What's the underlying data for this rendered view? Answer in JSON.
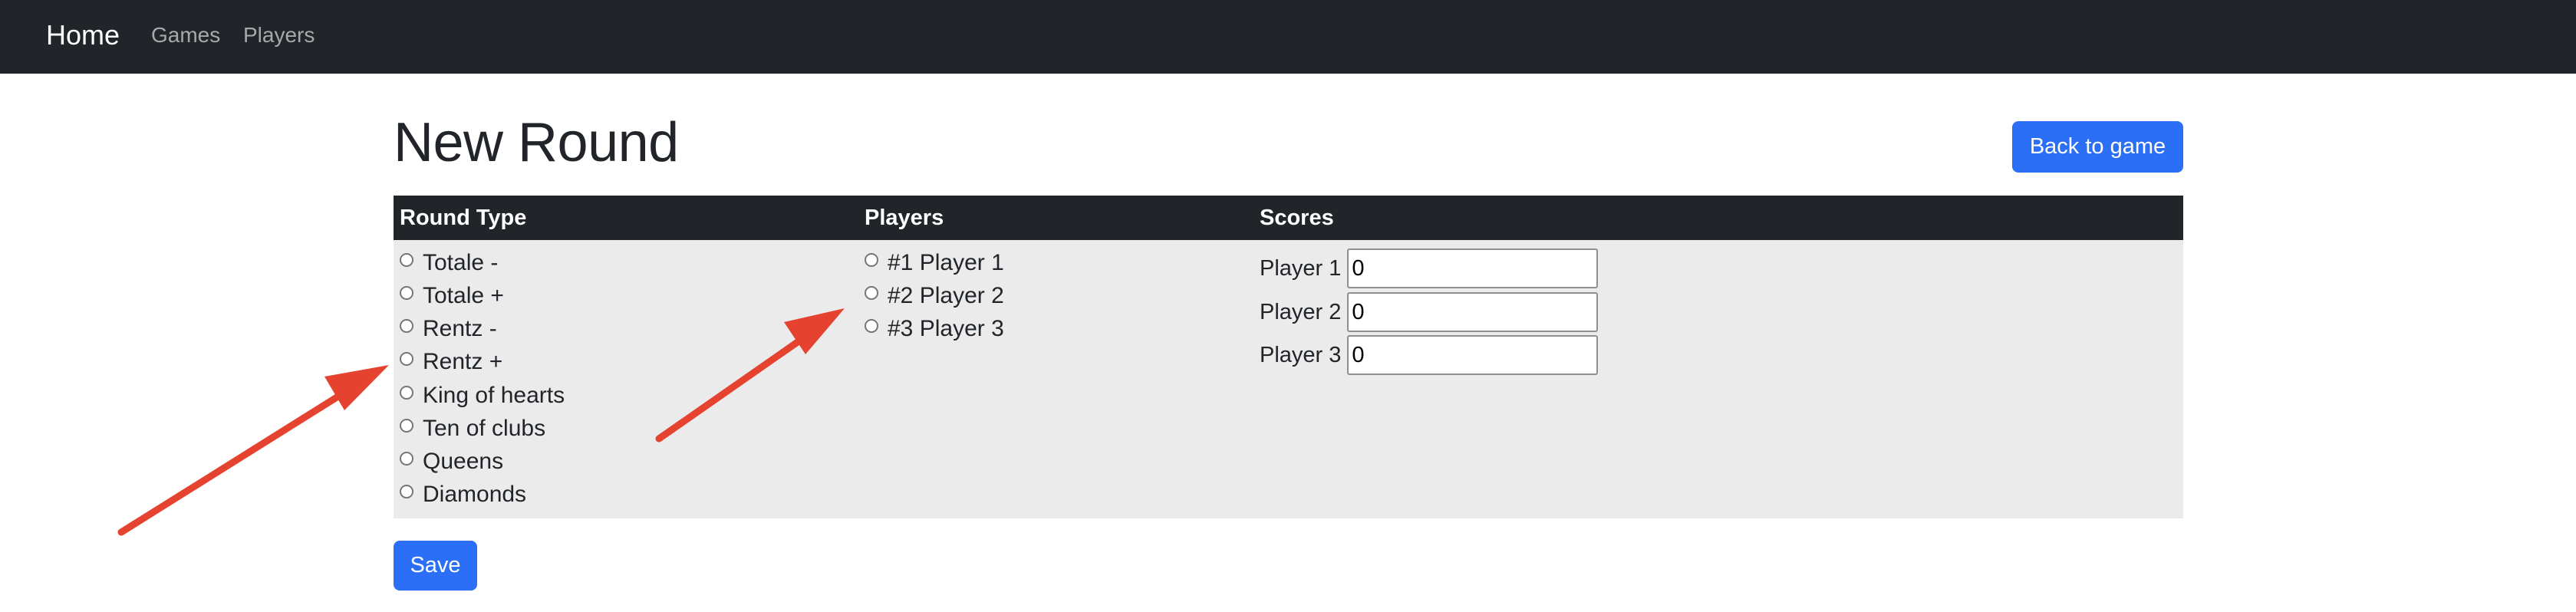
{
  "navbar": {
    "brand": "Home",
    "links": [
      "Games",
      "Players"
    ]
  },
  "page": {
    "title": "New Round",
    "back_button": "Back to game",
    "save_button": "Save"
  },
  "table": {
    "headers": [
      "Round Type",
      "Players",
      "Scores"
    ],
    "round_types": [
      "Totale -",
      "Totale +",
      "Rentz -",
      "Rentz +",
      "King of hearts",
      "Ten of clubs",
      "Queens",
      "Diamonds"
    ],
    "players": [
      "#1 Player 1",
      "#2 Player 2",
      "#3 Player 3"
    ],
    "scores": [
      {
        "label": "Player 1",
        "value": "0"
      },
      {
        "label": "Player 2",
        "value": "0"
      },
      {
        "label": "Player 3",
        "value": "0"
      }
    ]
  },
  "colors": {
    "navbar_bg": "#212529",
    "primary": "#2a6ff5",
    "table_bg": "#ebebeb",
    "annotation_arrow": "#e5432f"
  }
}
